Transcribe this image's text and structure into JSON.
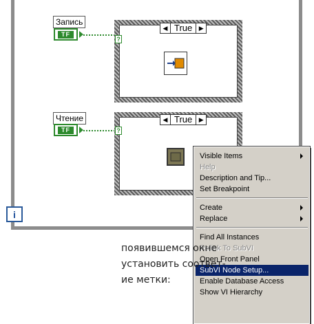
{
  "controls": {
    "write": {
      "label": "Запись",
      "tf": "TF"
    },
    "read": {
      "label": "Чтение",
      "tf": "TF"
    }
  },
  "cases": {
    "top": {
      "value": "True"
    },
    "bottom": {
      "value": "True"
    }
  },
  "terminal_symbol": "?",
  "loop_iteration_symbol": "i",
  "context_menu": {
    "groups": [
      [
        {
          "label": "Visible Items",
          "enabled": true,
          "submenu": true
        },
        {
          "label": "Help",
          "enabled": false,
          "submenu": false
        },
        {
          "label": "Description and Tip...",
          "enabled": true,
          "submenu": false
        },
        {
          "label": "Set Breakpoint",
          "enabled": true,
          "submenu": false
        }
      ],
      [
        {
          "label": "Create",
          "enabled": true,
          "submenu": true
        },
        {
          "label": "Replace",
          "enabled": true,
          "submenu": true
        }
      ],
      [
        {
          "label": "Find All Instances",
          "enabled": true,
          "submenu": false
        },
        {
          "label": "Relink To SubVI",
          "enabled": false,
          "submenu": false
        },
        {
          "label": "Open Front Panel",
          "enabled": true,
          "submenu": false
        },
        {
          "label": "SubVI Node Setup...",
          "enabled": true,
          "submenu": false,
          "selected": true
        },
        {
          "label": "Enable Database Access",
          "enabled": true,
          "submenu": false
        },
        {
          "label": "Show VI Hierarchy",
          "enabled": true,
          "submenu": false
        }
      ]
    ]
  },
  "text_fragment": {
    "line1": "появившемся  окне",
    "line2": "установить соответ-",
    "line3": "ие метки:"
  },
  "colors": {
    "boolean_green": "#2d8a2d",
    "menu_background": "#d4d0c8",
    "menu_highlight": "#0a246a",
    "loop_border": "#8c8c8c"
  }
}
